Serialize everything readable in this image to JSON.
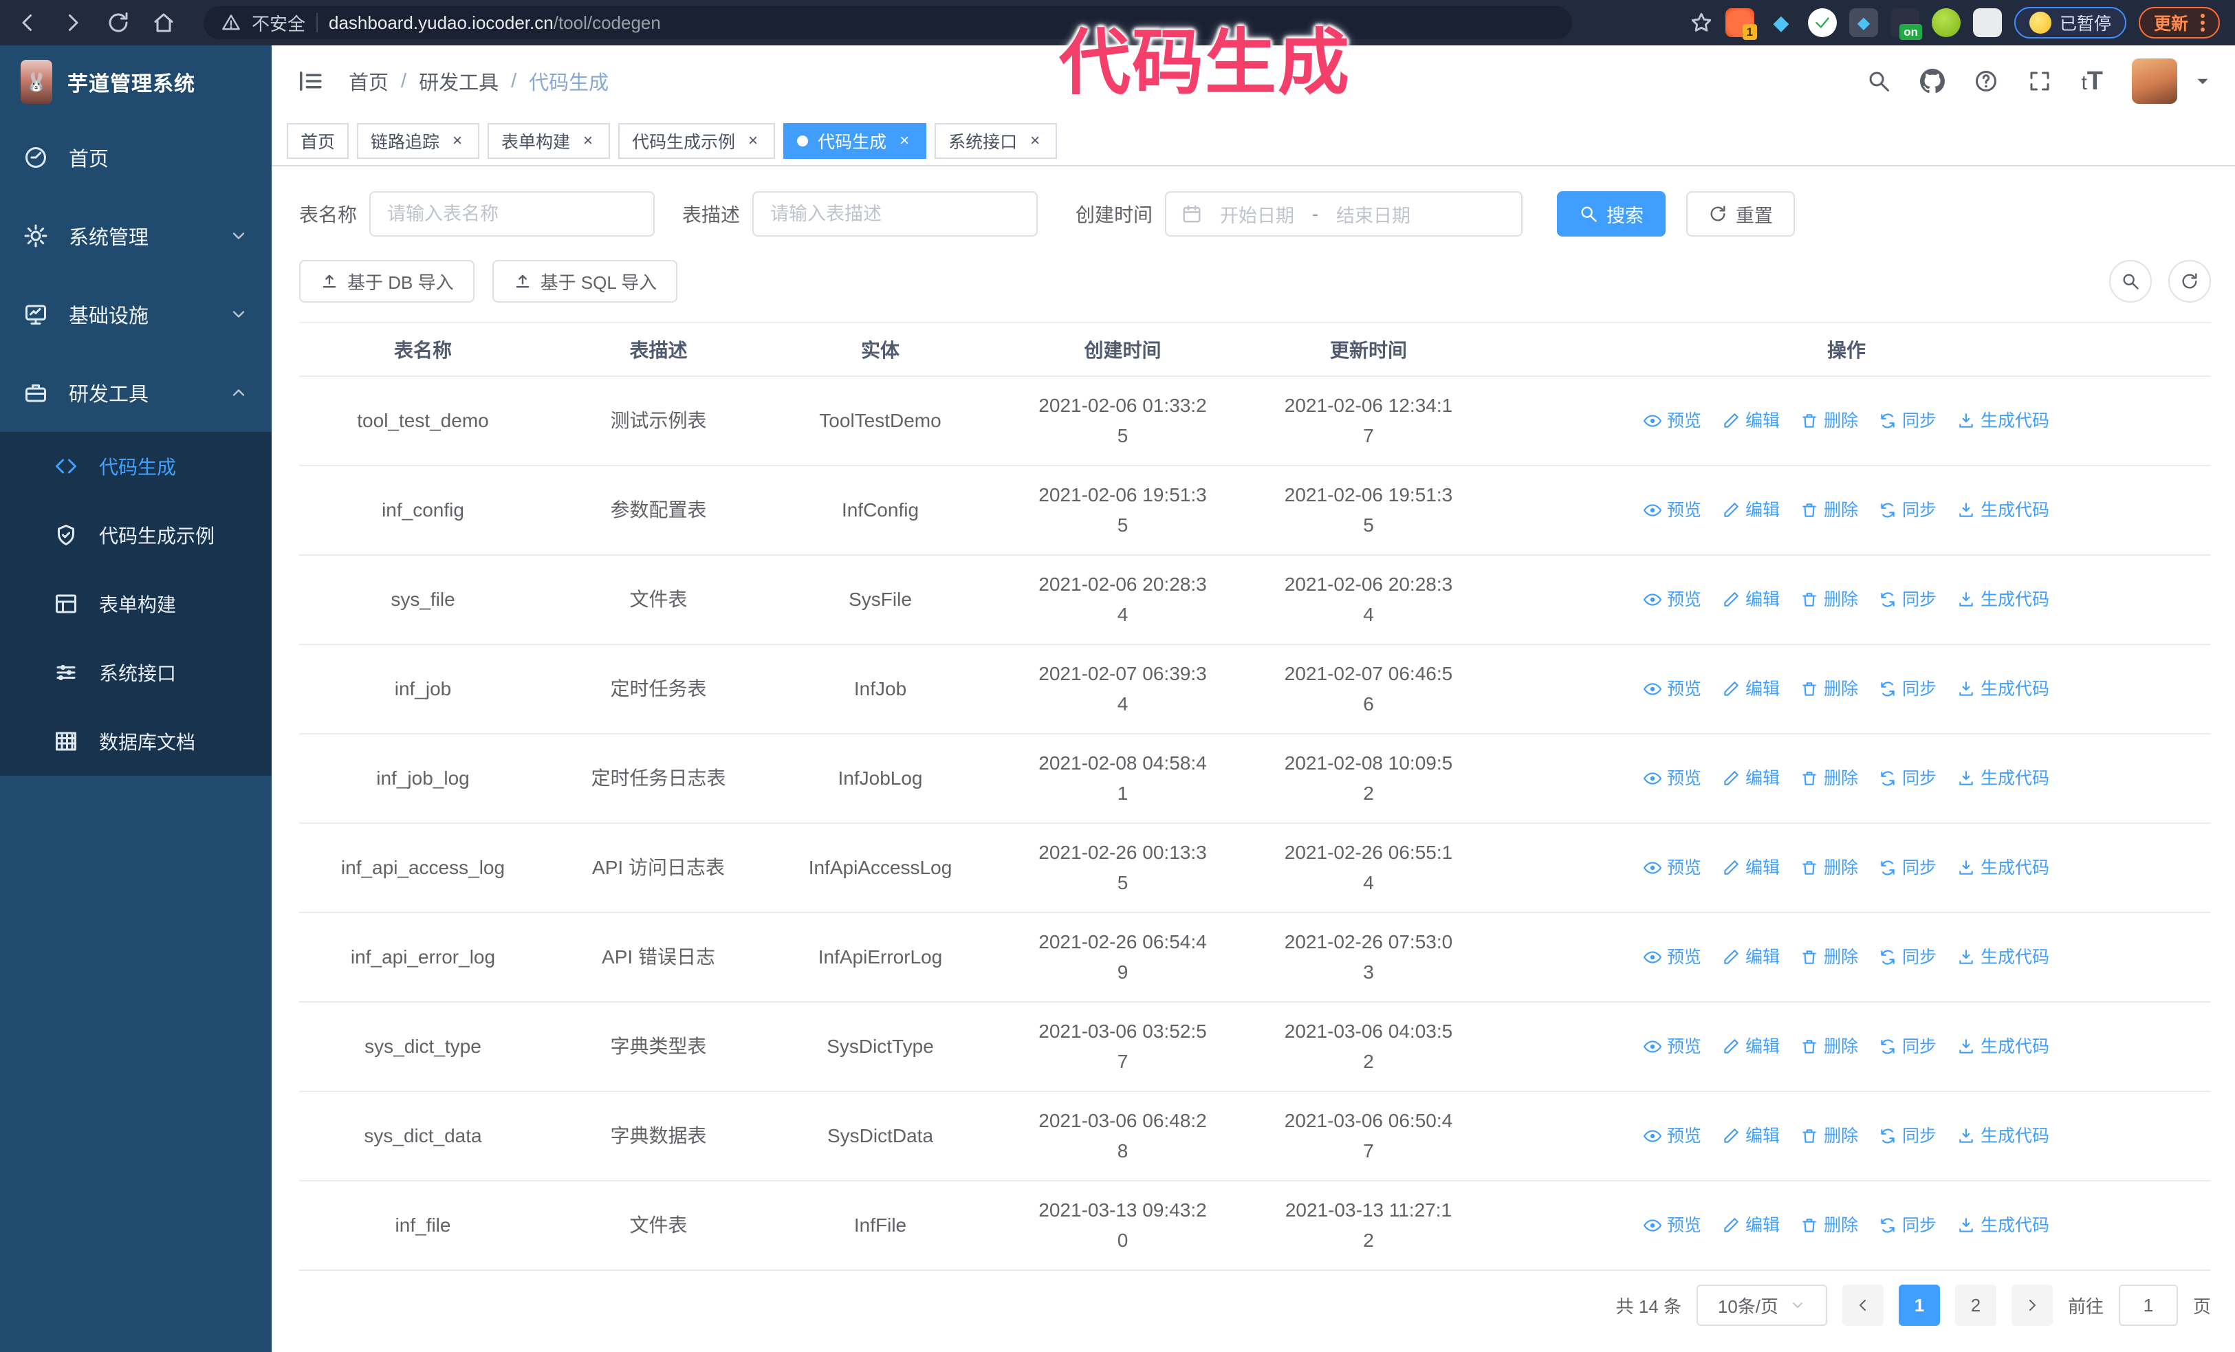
{
  "browser": {
    "security_label": "不安全",
    "url_host": "dashboard.yudao.iocoder.cn",
    "url_path": "/tool/codegen",
    "extension_count_badge": "1",
    "extension_on_badge": "on",
    "paused_badge": "已暂停",
    "update_button": "更新"
  },
  "annotation": {
    "text": "代码生成"
  },
  "app": {
    "title": "芋道管理系统",
    "breadcrumb": {
      "items": [
        {
          "label": "首页"
        },
        {
          "label": "研发工具"
        },
        {
          "label": "代码生成"
        }
      ]
    }
  },
  "tabs": {
    "items": [
      {
        "label": "首页"
      },
      {
        "label": "链路追踪"
      },
      {
        "label": "表单构建"
      },
      {
        "label": "代码生成示例"
      },
      {
        "label": "代码生成"
      },
      {
        "label": "系统接口"
      }
    ]
  },
  "sidebar": {
    "items": [
      {
        "label": "首页",
        "icon": "dashboard-icon"
      },
      {
        "label": "系统管理",
        "icon": "gear-icon"
      },
      {
        "label": "基础设施",
        "icon": "monitor-icon"
      },
      {
        "label": "研发工具",
        "icon": "toolbox-icon"
      }
    ],
    "subitems": [
      {
        "label": "代码生成",
        "icon": "code-icon",
        "active": true
      },
      {
        "label": "代码生成示例",
        "icon": "shield-check-icon"
      },
      {
        "label": "表单构建",
        "icon": "form-icon"
      },
      {
        "label": "系统接口",
        "icon": "sliders-icon"
      },
      {
        "label": "数据库文档",
        "icon": "grid-icon"
      }
    ]
  },
  "search": {
    "name_label": "表名称",
    "name_placeholder": "请输入表名称",
    "desc_label": "表描述",
    "desc_placeholder": "请输入表描述",
    "time_label": "创建时间",
    "start_placeholder": "开始日期",
    "range_separator": "-",
    "end_placeholder": "结束日期",
    "search_label": "搜索",
    "reset_label": "重置"
  },
  "toolbar": {
    "import_db_label": "基于 DB 导入",
    "import_sql_label": "基于 SQL 导入"
  },
  "table": {
    "columns": [
      "表名称",
      "表描述",
      "实体",
      "创建时间",
      "更新时间",
      "操作"
    ],
    "actions": [
      {
        "label": "预览"
      },
      {
        "label": "编辑"
      },
      {
        "label": "删除"
      },
      {
        "label": "同步"
      },
      {
        "label": "生成代码"
      }
    ],
    "rows": [
      {
        "name": "tool_test_demo",
        "desc": "测试示例表",
        "entity": "ToolTestDemo",
        "created": "2021-02-06 01:33:25",
        "updated": "2021-02-06 12:34:17"
      },
      {
        "name": "inf_config",
        "desc": "参数配置表",
        "entity": "InfConfig",
        "created": "2021-02-06 19:51:35",
        "updated": "2021-02-06 19:51:35"
      },
      {
        "name": "sys_file",
        "desc": "文件表",
        "entity": "SysFile",
        "created": "2021-02-06 20:28:34",
        "updated": "2021-02-06 20:28:34"
      },
      {
        "name": "inf_job",
        "desc": "定时任务表",
        "entity": "InfJob",
        "created": "2021-02-07 06:39:34",
        "updated": "2021-02-07 06:46:56"
      },
      {
        "name": "inf_job_log",
        "desc": "定时任务日志表",
        "entity": "InfJobLog",
        "created": "2021-02-08 04:58:41",
        "updated": "2021-02-08 10:09:52"
      },
      {
        "name": "inf_api_access_log",
        "desc": "API 访问日志表",
        "entity": "InfApiAccessLog",
        "created": "2021-02-26 00:13:35",
        "updated": "2021-02-26 06:55:14"
      },
      {
        "name": "inf_api_error_log",
        "desc": "API 错误日志",
        "entity": "InfApiErrorLog",
        "created": "2021-02-26 06:54:49",
        "updated": "2021-02-26 07:53:03"
      },
      {
        "name": "sys_dict_type",
        "desc": "字典类型表",
        "entity": "SysDictType",
        "created": "2021-03-06 03:52:57",
        "updated": "2021-03-06 04:03:52"
      },
      {
        "name": "sys_dict_data",
        "desc": "字典数据表",
        "entity": "SysDictData",
        "created": "2021-03-06 06:48:28",
        "updated": "2021-03-06 06:50:47"
      },
      {
        "name": "inf_file",
        "desc": "文件表",
        "entity": "InfFile",
        "created": "2021-03-13 09:43:20",
        "updated": "2021-03-13 11:27:12"
      }
    ]
  },
  "pagination": {
    "total_label": "共 14 条",
    "page_size": "10条/页",
    "pages": [
      "1",
      "2"
    ],
    "active_page": "1",
    "goto_label": "前往",
    "goto_value": "1",
    "goto_suffix": "页"
  },
  "colors": {
    "primary": "#409EFF",
    "sidebar_bg": "#214b6e",
    "submenu_bg": "#17334e",
    "annotation": "#f43f6b"
  }
}
